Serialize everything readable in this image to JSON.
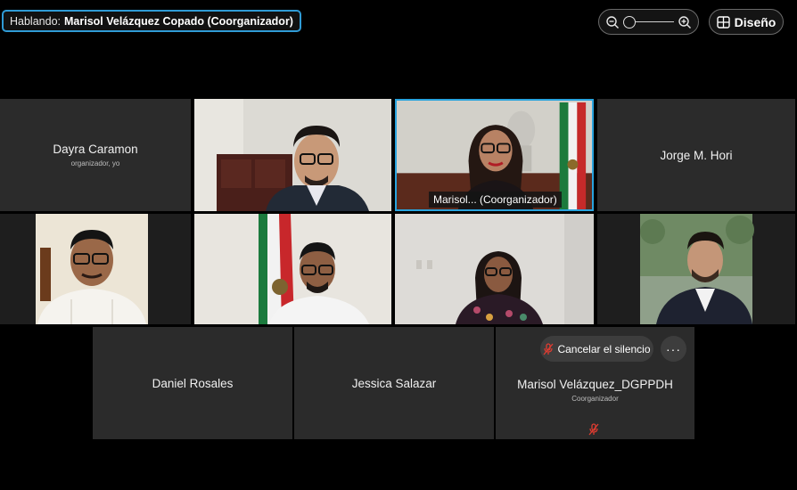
{
  "speaking": {
    "label": "Hablando:",
    "who": "Marisol Velázquez Copado (Coorganizador)"
  },
  "zoom": {
    "out_icon": "zoom-out-icon",
    "in_icon": "zoom-in-icon",
    "level": 0
  },
  "layout_button": {
    "label": "Diseño",
    "icon": "grid-icon"
  },
  "participants": {
    "dayra": {
      "name": "Dayra Caramon",
      "role": "organizador, yo"
    },
    "jorge": {
      "name": "Jorge M. Hori"
    },
    "marisol_video": {
      "tag": "Marisol...  (Coorganizador)"
    },
    "daniel": {
      "name": "Daniel Rosales"
    },
    "jessica": {
      "name": "Jessica Salazar"
    },
    "marisol_dgppdh": {
      "name": "Marisol Velázquez_DGPPDH",
      "role": "Coorganizador"
    }
  },
  "actions": {
    "unmute_label": "Cancelar el silencio",
    "more_label": "···"
  },
  "colors": {
    "active_border": "#29a3dd",
    "speaking_border": "#2f9bd6",
    "tile_bg": "#2b2b2b",
    "muted_red": "#e03c31"
  }
}
